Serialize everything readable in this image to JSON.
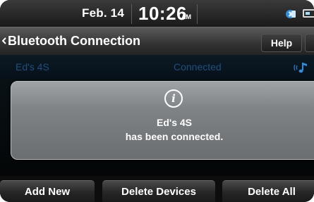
{
  "status_bar": {
    "date": "Feb. 14",
    "time": "10:26",
    "ampm": "AM"
  },
  "header": {
    "title": "Bluetooth Connection",
    "help_label": "Help"
  },
  "devices": [
    {
      "name": "Ed's 4S",
      "status": "Connected"
    }
  ],
  "popup": {
    "line1": "Ed's 4S",
    "line2": "has been connected."
  },
  "softkeys": {
    "add_new": "Add New",
    "delete_devices": "Delete Devices",
    "delete_all": "Delete All"
  },
  "icons": {
    "status_bluetooth": "bluetooth-phone-icon",
    "battery": "battery-icon",
    "info": "info-icon",
    "audio": "audio-streaming-icon",
    "back": "chevron-left-icon"
  },
  "colors": {
    "accent_blue": "#1f4f7e",
    "popup_gray": "#7f8385",
    "icon_blue": "#2a8fe0"
  }
}
